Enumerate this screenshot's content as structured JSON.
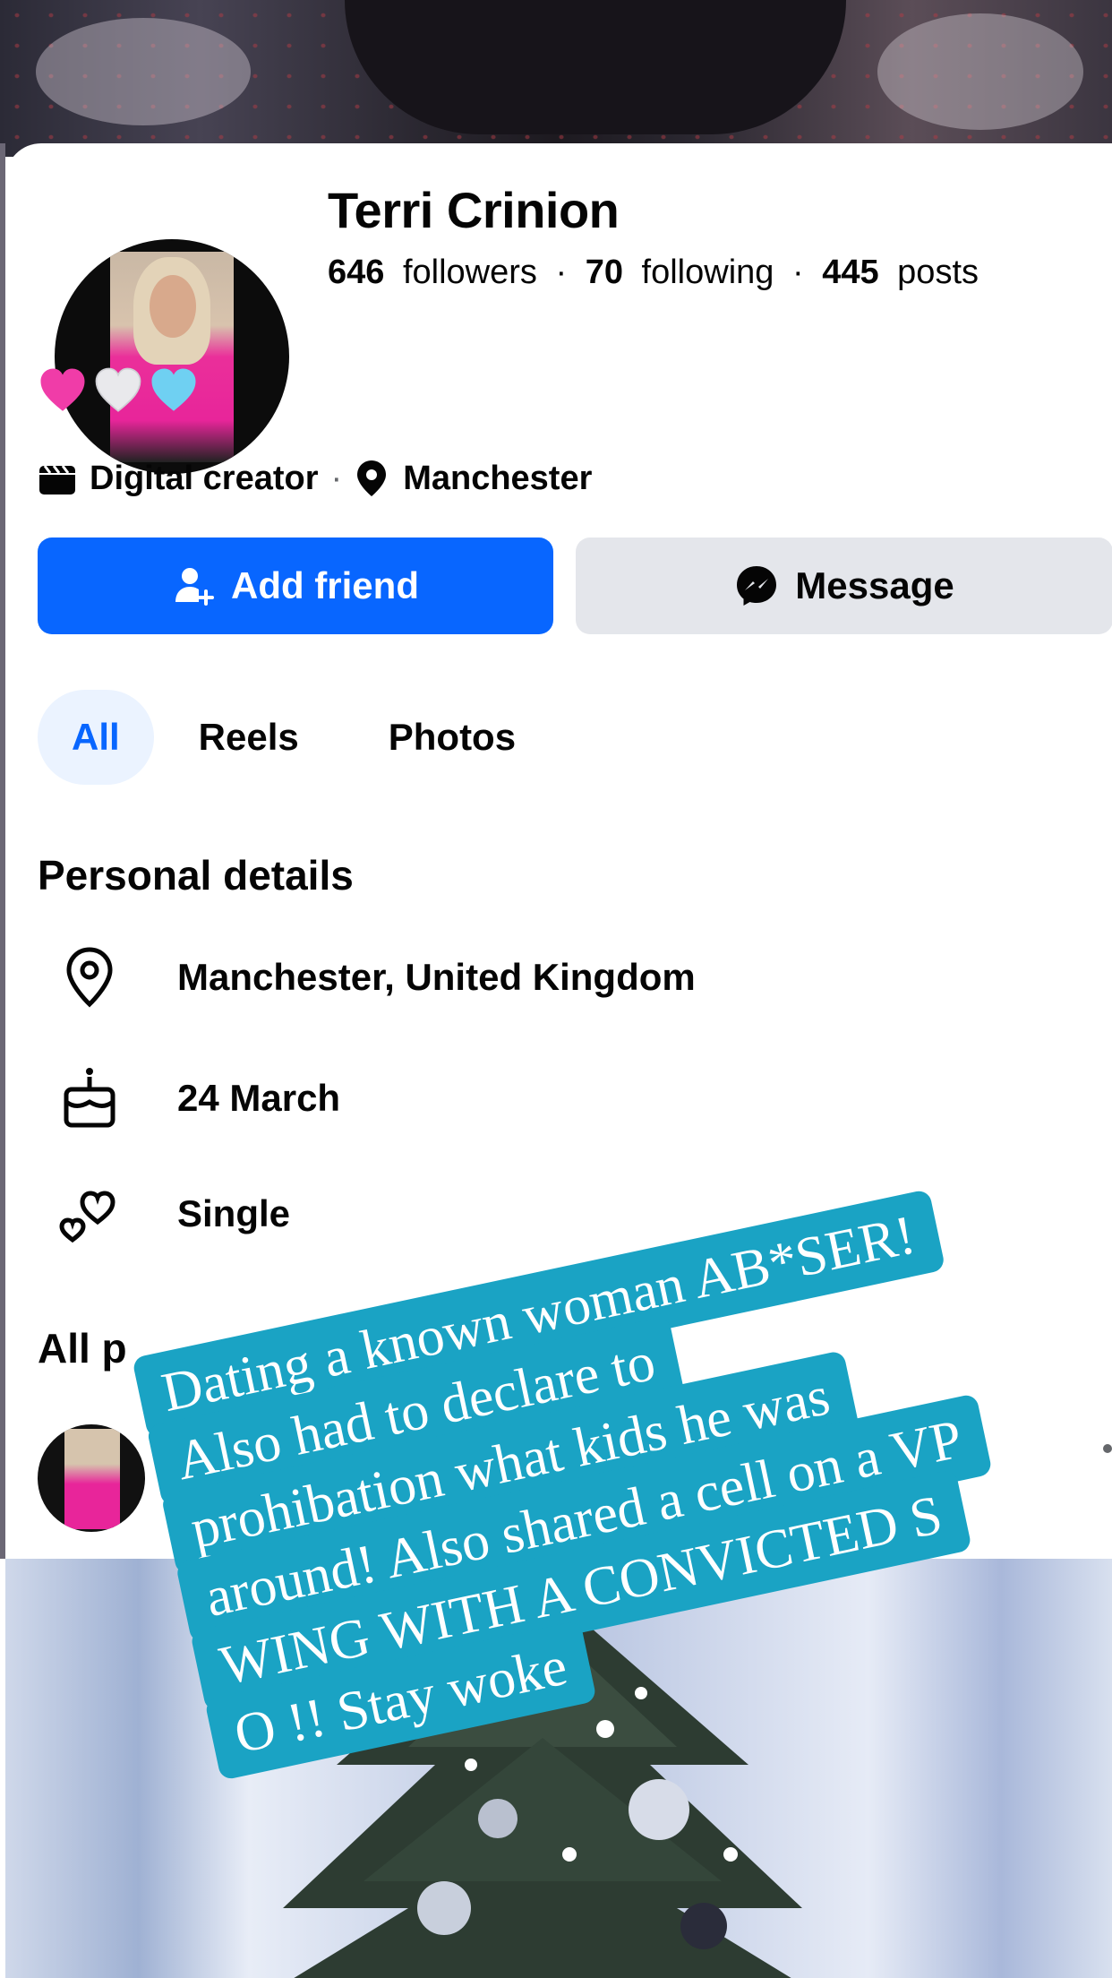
{
  "profile": {
    "name": "Terri Crinion",
    "stats": {
      "followers_count": "646",
      "followers_label": "followers",
      "following_count": "70",
      "following_label": "following",
      "posts_count": "445",
      "posts_label": "posts",
      "separator": "·"
    },
    "emoji_hearts": [
      "pink-heart",
      "white-heart",
      "light-blue-heart"
    ],
    "category": "Digital creator",
    "location": "Manchester",
    "meta_separator": "·"
  },
  "actions": {
    "add_friend_label": "Add friend",
    "message_label": "Message"
  },
  "tabs": [
    {
      "label": "All",
      "active": true
    },
    {
      "label": "Reels",
      "active": false
    },
    {
      "label": "Photos",
      "active": false
    }
  ],
  "personal_details": {
    "title": "Personal details",
    "items": [
      {
        "icon": "location-pin-icon",
        "text": "Manchester, United Kingdom"
      },
      {
        "icon": "birthday-cake-icon",
        "text": "24 March"
      },
      {
        "icon": "hearts-icon",
        "text": "Single"
      }
    ]
  },
  "posts": {
    "title": "All p"
  },
  "overlay": {
    "color": "#1aa3c4",
    "lines": [
      "Dating a known woman AB*SER!",
      "Also had to declare to",
      "prohibation what kids he was",
      "around! Also shared a cell on a VP",
      "WING WITH A CONVICTED S",
      "O !! Stay woke"
    ]
  },
  "colors": {
    "primary_blue": "#0866ff",
    "tab_active_bg": "#ebf3ff",
    "secondary_button": "#e4e6eb"
  }
}
